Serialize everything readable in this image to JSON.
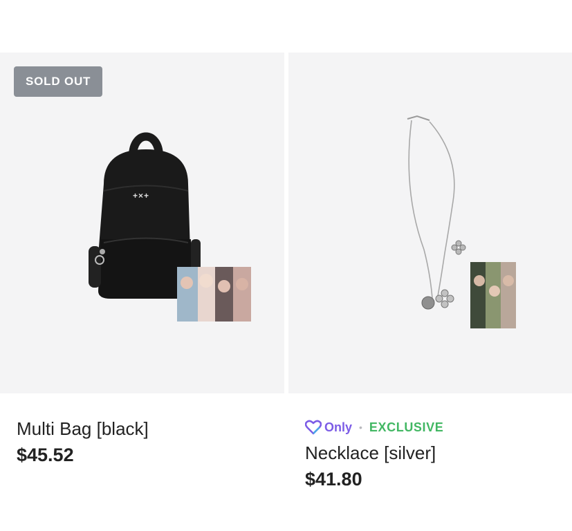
{
  "colors": {
    "image_bg": "#f4f4f5",
    "badge_bg": "#8a8f96",
    "only_purple": "#7c5ce6",
    "exclusive_green": "#42b763"
  },
  "products": [
    {
      "badge": "SOLD OUT",
      "name": "Multi Bag [black]",
      "price": "$45.52",
      "bag_logo": "+×+"
    },
    {
      "tag_brand": "Only",
      "tag_separator": "•",
      "tag_label": "EXCLUSIVE",
      "brand_icon": "heart-logo-icon",
      "name": "Necklace [silver]",
      "price": "$41.80"
    }
  ]
}
